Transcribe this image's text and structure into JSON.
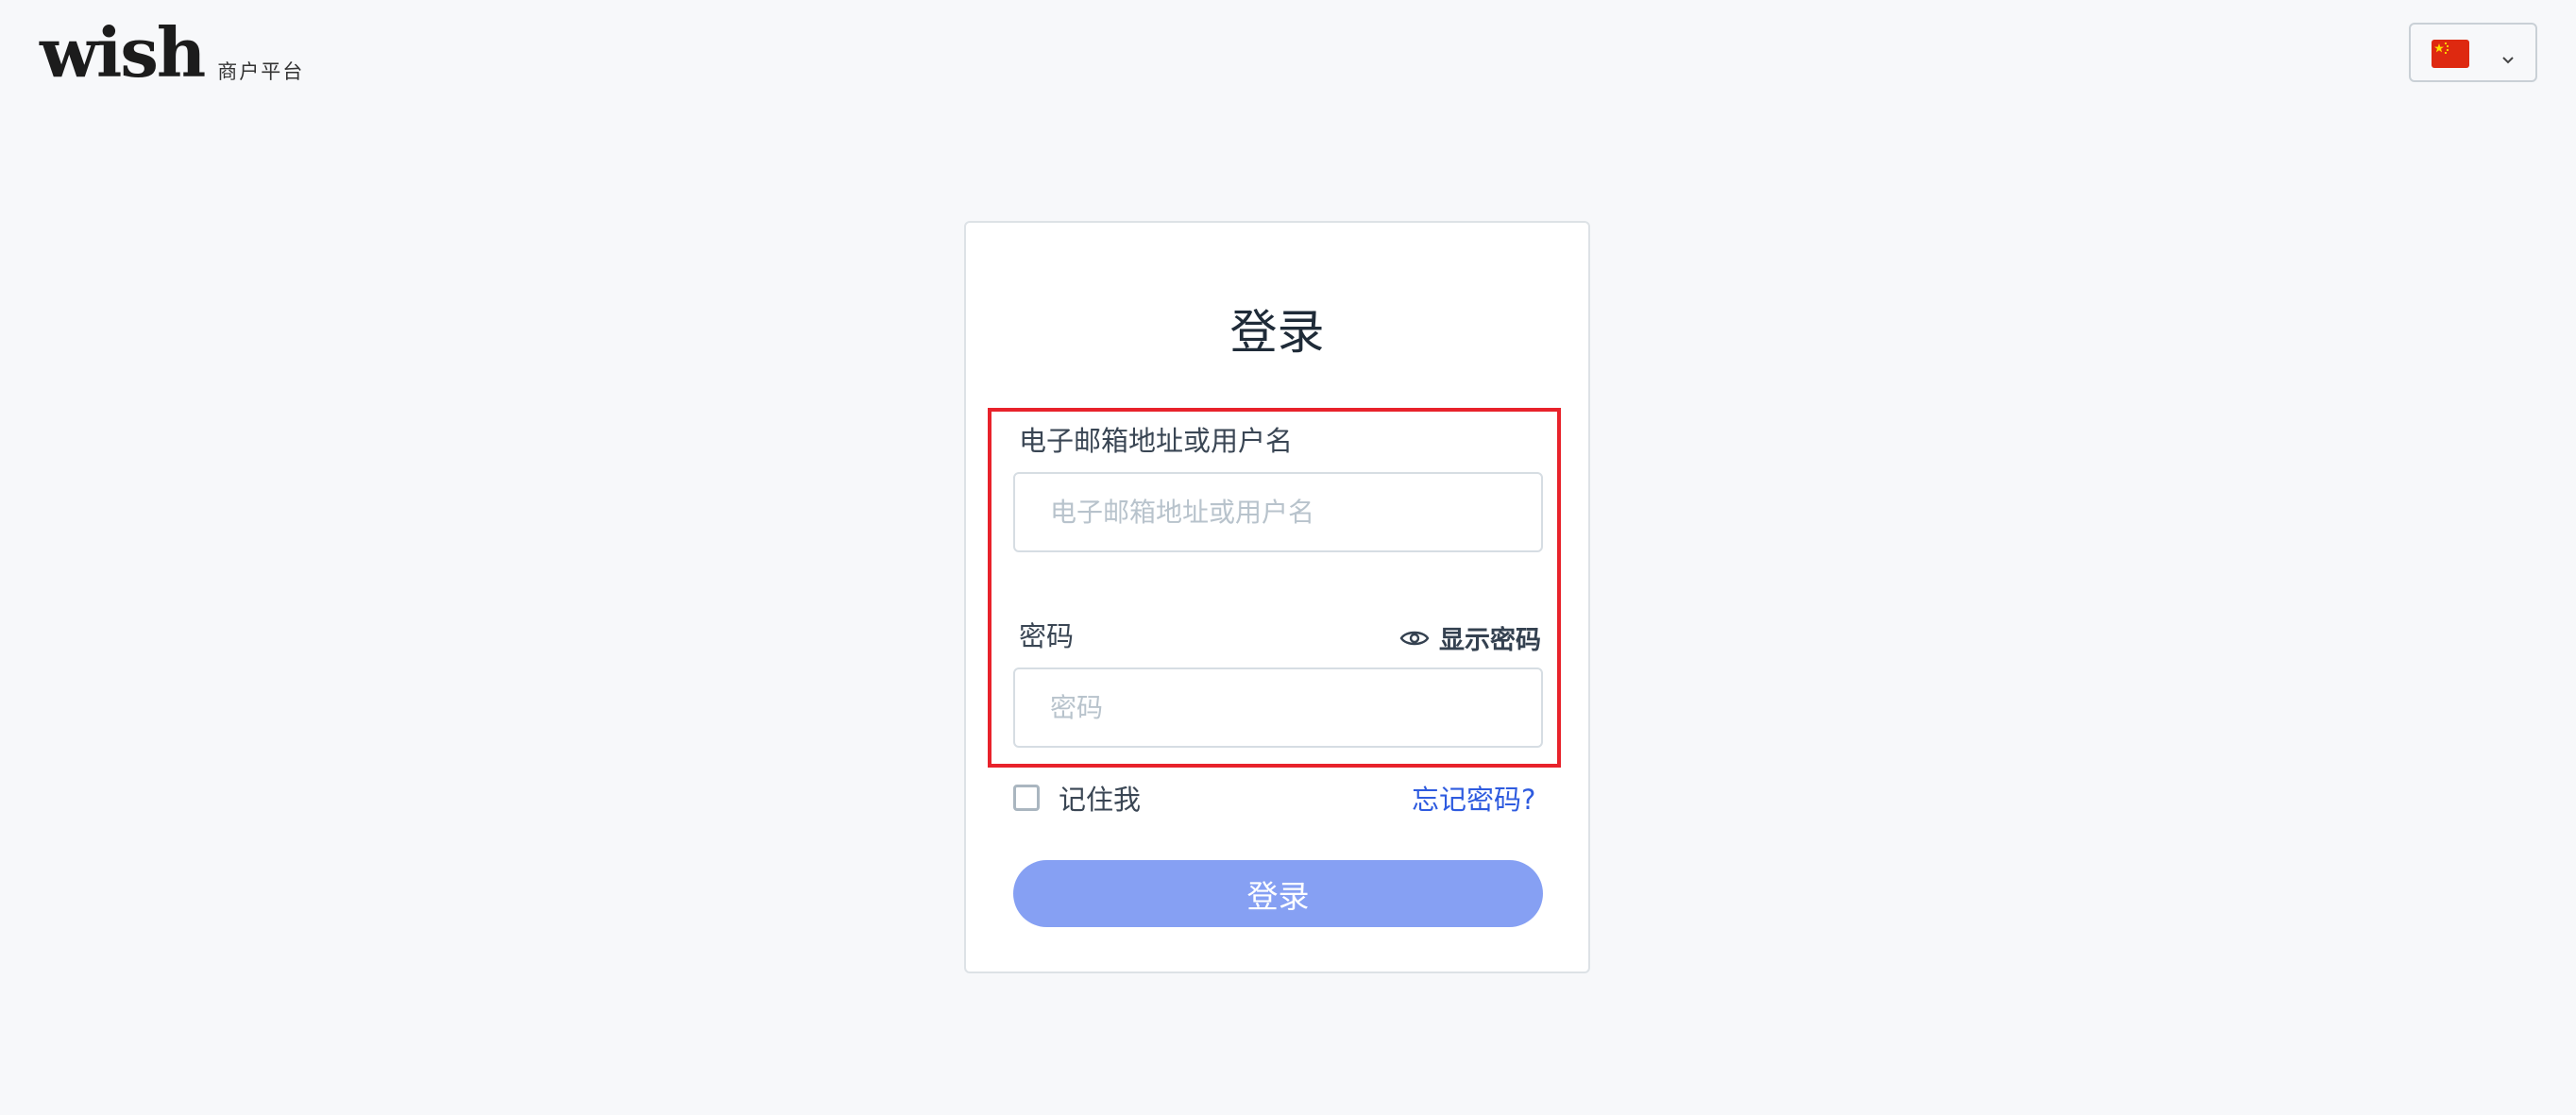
{
  "header": {
    "logo_text": "wish",
    "logo_subtitle": "商户平台",
    "language_selector": {
      "icon": "china-flag-icon",
      "dropdown_icon": "chevron-down-icon"
    }
  },
  "login_card": {
    "title": "登录",
    "email": {
      "label": "电子邮箱地址或用户名",
      "placeholder": "电子邮箱地址或用户名",
      "value": ""
    },
    "password": {
      "label": "密码",
      "placeholder": "密码",
      "value": "",
      "show_label": "显示密码",
      "show_icon": "eye-icon"
    },
    "remember_me": {
      "label": "记住我",
      "checked": false
    },
    "forgot_password": "忘记密码?",
    "submit_label": "登录"
  },
  "colors": {
    "accent": "#2e5bdf",
    "button_disabled": "#86a0f3",
    "highlight": "#e8222b",
    "flag_red": "#de2910",
    "flag_star": "#ffde00"
  }
}
